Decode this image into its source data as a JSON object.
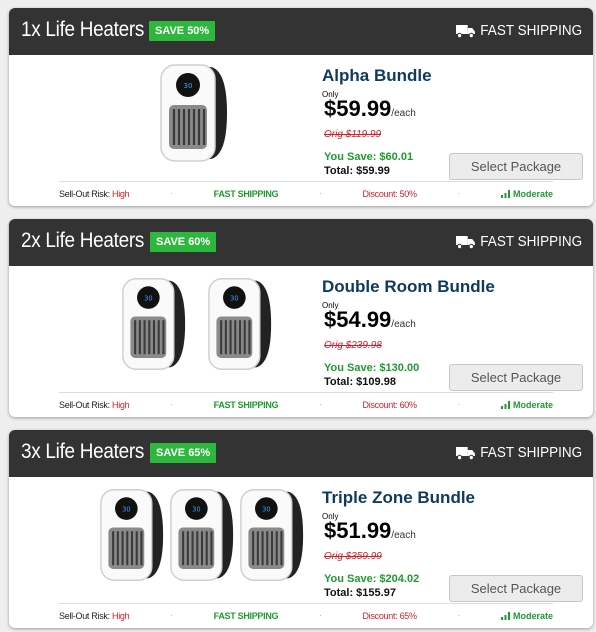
{
  "packages": [
    {
      "header_title": "1x Life Heaters",
      "save_badge": "SAVE 50%",
      "shipping_label": "FAST SHIPPING",
      "bundle_name": "Alpha Bundle",
      "only_label": "Only",
      "price": "$59.99",
      "per_unit": "/each",
      "orig_price": "Orig $119.99",
      "you_save": "You Save: $60.01",
      "total": "Total: $59.99",
      "select_label": "Select Package",
      "risk_label": "Sell-Out Risk:",
      "risk_value": "High",
      "footer_shipping": "FAST SHIPPING",
      "discount": "Discount: 50%",
      "stock_level": "Moderate",
      "heater_count": 1
    },
    {
      "header_title": "2x Life Heaters",
      "save_badge": "SAVE 60%",
      "shipping_label": "FAST SHIPPING",
      "bundle_name": "Double Room Bundle",
      "only_label": "Only",
      "price": "$54.99",
      "per_unit": "/each",
      "orig_price": "Orig $239.98",
      "you_save": "You Save: $130.00",
      "total": "Total: $109.98",
      "select_label": "Select Package",
      "risk_label": "Sell-Out Risk:",
      "risk_value": "High",
      "footer_shipping": "FAST SHIPPING",
      "discount": "Discount: 60%",
      "stock_level": "Moderate",
      "heater_count": 2
    },
    {
      "header_title": "3x Life Heaters",
      "save_badge": "SAVE 65%",
      "shipping_label": "FAST SHIPPING",
      "bundle_name": "Triple Zone Bundle",
      "only_label": "Only",
      "price": "$51.99",
      "per_unit": "/each",
      "orig_price": "Orig $359.99",
      "you_save": "You Save: $204.02",
      "total": "Total: $155.97",
      "select_label": "Select Package",
      "risk_label": "Sell-Out Risk:",
      "risk_value": "High",
      "footer_shipping": "FAST SHIPPING",
      "discount": "Discount: 65%",
      "stock_level": "Moderate",
      "heater_count": 3
    }
  ],
  "icons": {
    "shipping": "truck-icon",
    "stock": "signal-bars-icon",
    "product": "heater-product-image"
  },
  "colors": {
    "header_bg": "#333333",
    "badge_green": "#2db83d",
    "title_navy": "#0e3a5e",
    "savings_green": "#1f9b2f",
    "strike_red": "#d0202a"
  }
}
